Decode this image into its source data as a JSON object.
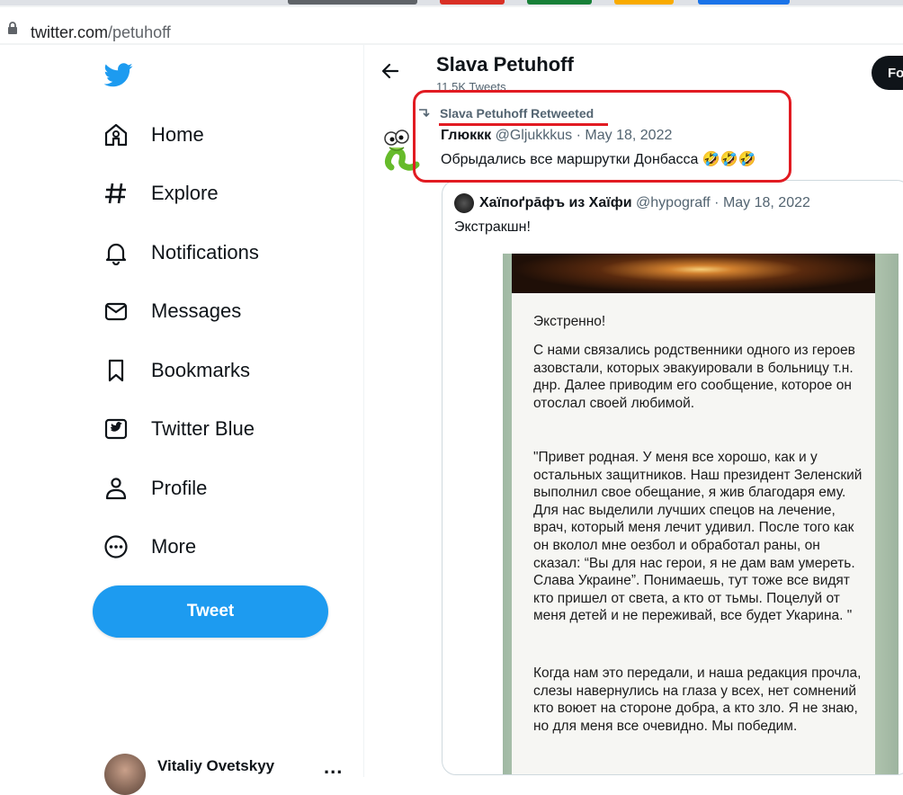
{
  "browser": {
    "url_host": "twitter.com",
    "url_path": "/petuhoff"
  },
  "sidebar": {
    "logo": "twitter-bird-icon",
    "nav": [
      {
        "label": "Home",
        "icon": "home-icon"
      },
      {
        "label": "Explore",
        "icon": "hashtag-icon"
      },
      {
        "label": "Notifications",
        "icon": "bell-icon"
      },
      {
        "label": "Messages",
        "icon": "envelope-icon"
      },
      {
        "label": "Bookmarks",
        "icon": "bookmark-icon"
      },
      {
        "label": "Twitter Blue",
        "icon": "twitter-blue-icon"
      },
      {
        "label": "Profile",
        "icon": "person-icon"
      },
      {
        "label": "More",
        "icon": "more-circle-icon"
      }
    ],
    "tweet_button": "Tweet",
    "account": {
      "name": "Vitaliy Ovetskyy",
      "more": "..."
    }
  },
  "header": {
    "name": "Slava Petuhoff",
    "tweets_count": "11.5K Tweets",
    "follow_label": "Fo"
  },
  "tweet": {
    "retweet_label": "Slava Petuhoff Retweeted",
    "author": "Глюккк",
    "handle": "@Gljukkkus",
    "separator": "·",
    "date": "May 18, 2022",
    "text": "Обрыдались все маршрутки Донбасса 🤣🤣🤣"
  },
  "quote": {
    "author": "Хаїпоґрāфъ из Хаїфи",
    "handle": "@hypograff",
    "separator": "·",
    "date": "May 18, 2022",
    "text": "Экстракшн!",
    "image_paragraphs": [
      "Экстренно!",
      "С нами связались родственники одного из героев азовстали, которых эвакуировали в больницу т.н. днр. Далее приводим его сообщение, которое он отослал своей любимой.",
      "\"Привет родная. У меня все хорошо, как и у остальных защитников. Наш президент Зеленский выполнил свое обещание, я жив благодаря ему. Для нас выделили лучших спецов на лечение, врач, который меня лечит удивил. После того как он вколол мне оезбол и обработал раны, он сказал: “Вы для нас герои, я не дам вам умереть. Слава Украине”. Понимаешь, тут тоже все видят кто пришел от света, а кто от тьмы. Поцелуй от меня детей и не переживай, все будет Укарина. \"",
      "Когда нам это передали, и наша редакция прочла, слезы навернулись на глаза у всех, нет сомнений кто воюет на стороне добра, а кто зло. Я не знаю, но для меня все очевидно. Мы победим."
    ]
  },
  "colors": {
    "accent": "#1d9bf0",
    "annotation": "#e11b22",
    "text": "#0f1419",
    "muted": "#536471"
  }
}
